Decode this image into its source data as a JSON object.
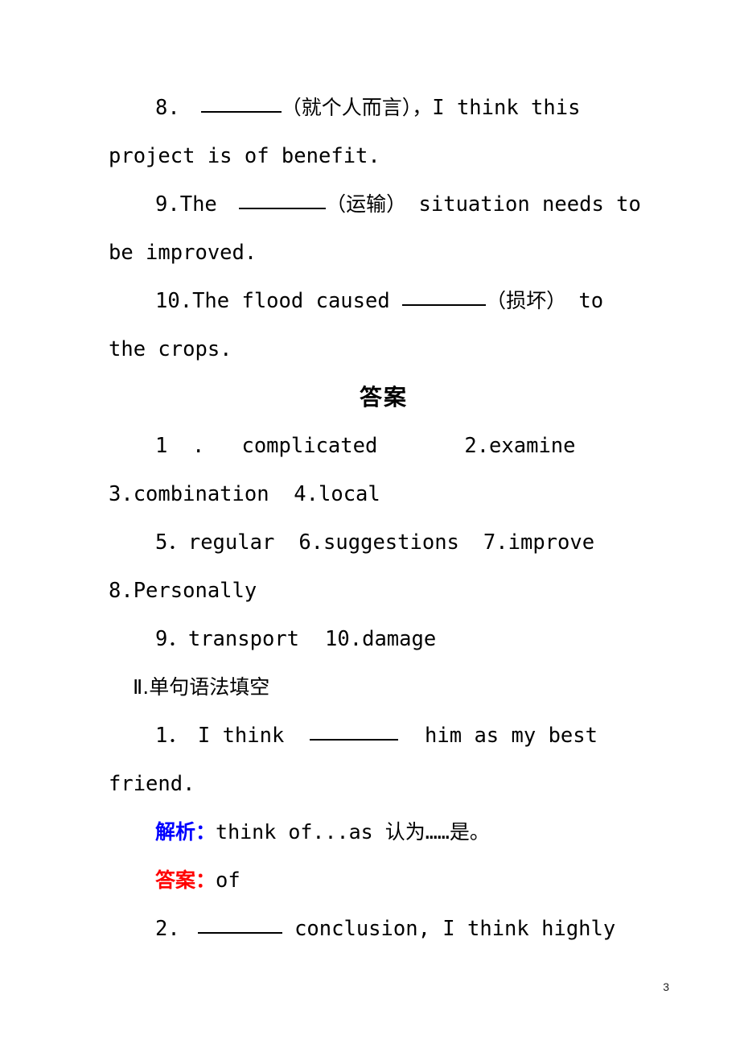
{
  "page": {
    "number": "3",
    "background_color": "#ffffff",
    "text_color": "#000000"
  },
  "colors": {
    "analysis_label": "#0000ff",
    "answer_label": "#ff0000",
    "body_text": "#000000"
  },
  "exercise_part_1": {
    "items": [
      {
        "number": "8.",
        "line1_pre": "",
        "hint": "（就个人而言），",
        "line1_post": "I think this",
        "line2": "project is of benefit."
      },
      {
        "number": "9.",
        "line1_pre": "The ",
        "hint": "（运输）",
        "line1_post": " situation needs to",
        "line2": "be improved."
      },
      {
        "number": "10.",
        "line1_pre": "The flood caused ",
        "hint": "（损坏）",
        "line1_post": " to",
        "line2": "the crops."
      }
    ]
  },
  "answers_heading": "答案",
  "answers_part_1": {
    "line1_left": "1  .   complicated",
    "line1_right": "2.examine",
    "line2": "3.combination  4.local",
    "line3_a": "5．regular",
    "line3_b": "6.suggestions",
    "line3_c": "7.improve",
    "line4": "8.Personally",
    "line5_a": "9．transport",
    "line5_b": "10.damage"
  },
  "section_2": {
    "heading": "Ⅱ.单句语法填空",
    "items": [
      {
        "number": "1．",
        "line1_pre": "I think ",
        "line1_post": " him as my best",
        "line2": "friend.",
        "analysis_label": "解析：",
        "analysis_text": "think of...as 认为……是。",
        "answer_label": "答案：",
        "answer_text": "of"
      },
      {
        "number": "2.",
        "line1_pre": "",
        "line1_post": " conclusion, I think highly"
      }
    ]
  }
}
